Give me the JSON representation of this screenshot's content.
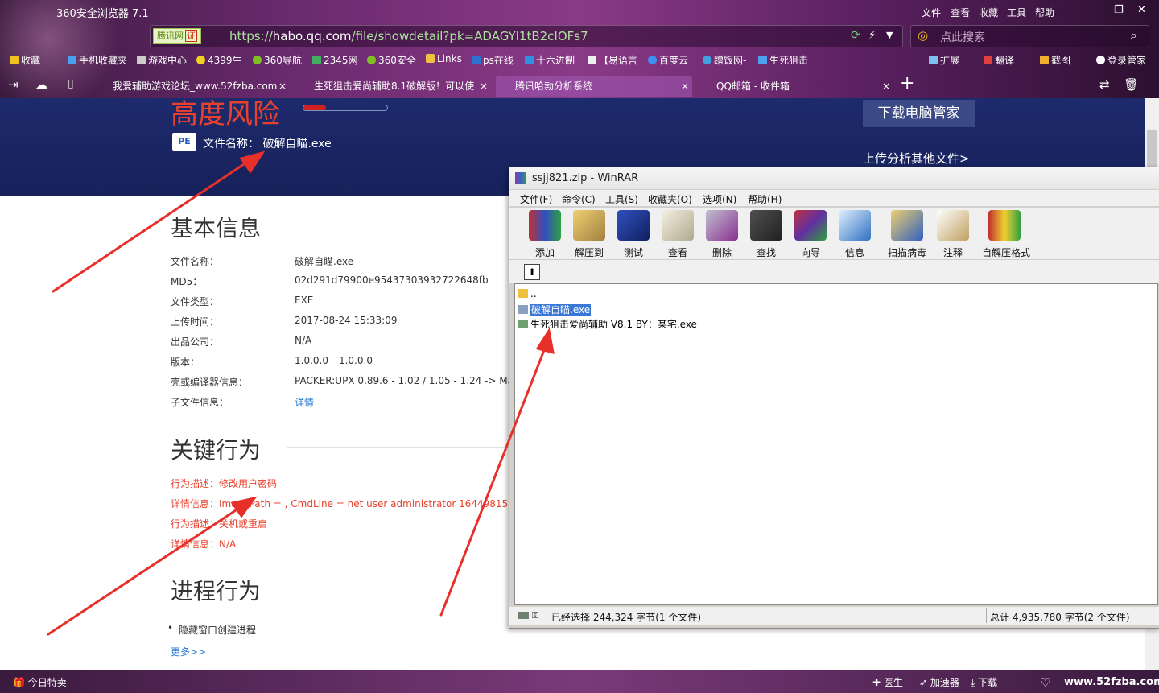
{
  "browser": {
    "title": "360安全浏览器 7.1",
    "menu": [
      "文件",
      "查看",
      "收藏",
      "工具",
      "帮助"
    ],
    "addr_badge": "腾讯网",
    "addr_badge_cert": "证",
    "url_scheme": "https://",
    "url_host": "habo.qq.com",
    "url_path": "/file/showdetail?pk=ADAGYl1tB2cIOFs7",
    "search_placeholder": "点此搜索",
    "bookmarks": [
      "收藏",
      "手机收藏夹",
      "游戏中心",
      "4399生",
      "360导航",
      "2345网",
      "360安全",
      "Links",
      "ps在线",
      "十六进制",
      "【易语言",
      "百度云",
      "蹭饭网-",
      "生死狙击"
    ],
    "bookmark_right": [
      "扩展",
      "翻译",
      "截图",
      "登录管家"
    ],
    "tabs": [
      {
        "label": "我爱辅助游戏论坛_www.52fzba.com"
      },
      {
        "label": "生死狙击爱尚辅助8.1破解版！可以使"
      },
      {
        "label": "腾讯哈勃分析系统"
      },
      {
        "label": "QQ邮箱 - 收件箱"
      }
    ],
    "tab_close": "×",
    "new_tab": "+"
  },
  "page": {
    "risk_title": "高度风险",
    "pe_icon": "PE",
    "file_name_label": "文件名称：",
    "file_name_value": "破解自瞄.exe",
    "download_button": "下载电脑管家",
    "upload_link": "上传分析其他文件>",
    "basic_info_title": "基本信息",
    "basic_info": [
      {
        "label": "文件名称：",
        "value": "破解自瞄.exe"
      },
      {
        "label": "MD5：",
        "value": "02d291d79900e95437303932722648fb"
      },
      {
        "label": "文件类型：",
        "value": "EXE"
      },
      {
        "label": "上传时间：",
        "value": "2017-08-24 15:33:09"
      },
      {
        "label": "出品公司：",
        "value": "N/A"
      },
      {
        "label": "版本：",
        "value": "1.0.0.0---1.0.0.0"
      },
      {
        "label": "壳或编译器信息：",
        "value": "PACKER:UPX 0.89.6 - 1.02 / 1.05 - 1.24 -> Ma"
      },
      {
        "label": "子文件信息：",
        "value": "详情"
      }
    ],
    "key_behavior_title": "关键行为",
    "key_behavior": [
      "行为描述：修改用户密码",
      "详情信息：ImagePath = , CmdLine = net user administrator 164498155",
      "行为描述：关机或重启",
      "详情信息：N/A"
    ],
    "process_title": "进程行为",
    "process_items": [
      "隐藏窗口创建进程"
    ],
    "more_link": "更多>>"
  },
  "winrar": {
    "title": "ssjj821.zip - WinRAR",
    "menu": [
      "文件(F)",
      "命令(C)",
      "工具(S)",
      "收藏夹(O)",
      "选项(N)",
      "帮助(H)"
    ],
    "tools": [
      "添加",
      "解压到",
      "测试",
      "查看",
      "删除",
      "查找",
      "向导",
      "信息",
      "扫描病毒",
      "注释",
      "自解压格式"
    ],
    "files": [
      {
        "name": ".."
      },
      {
        "name": "破解自瞄.exe"
      },
      {
        "name": "生死狙击爱尚辅助 V8.1 BY：某宅.exe"
      }
    ],
    "status_left": "已经选择 244,324 字节(1 个文件)",
    "status_right": "总计 4,935,780 字节(2 个文件)"
  },
  "statusbar": {
    "left": "今日特卖",
    "items": [
      "医生",
      "加速器",
      "下载"
    ],
    "watermark": "www.52fzba.com"
  },
  "colors": {
    "risk": "#e8422e",
    "banner": "#1d2a6c",
    "selection": "#3a78d8",
    "arrow": "#e8302a"
  }
}
